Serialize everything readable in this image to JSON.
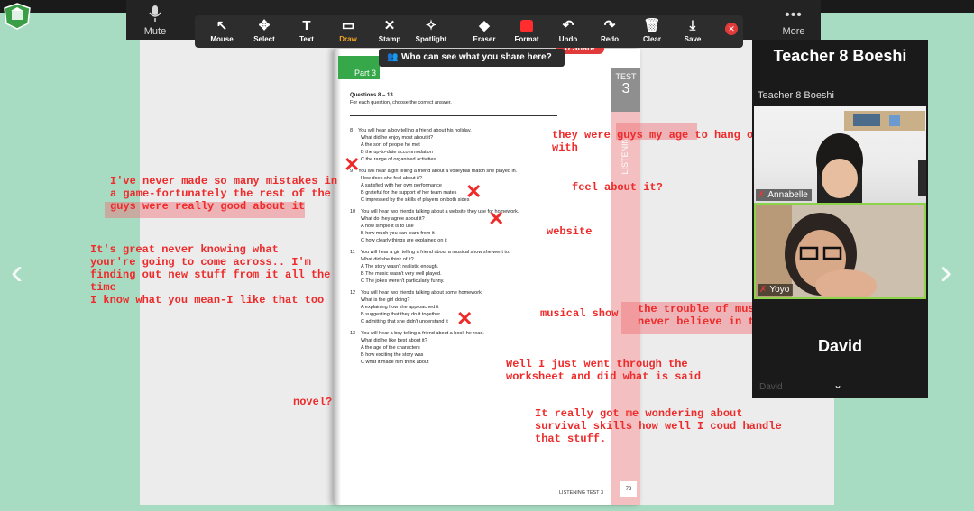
{
  "meeting_bar": {
    "mute_label": "Mute",
    "more_label": "More",
    "more_glyph": "•••",
    "mic_icon": "microphone-icon"
  },
  "annotation_toolbar": {
    "tools": [
      {
        "label": "Mouse",
        "icon": "mouse-pointer-icon",
        "glyph": "↖"
      },
      {
        "label": "Select",
        "icon": "select-move-icon",
        "glyph": "✥"
      },
      {
        "label": "Text",
        "icon": "text-icon",
        "glyph": "T"
      },
      {
        "label": "Draw",
        "icon": "draw-icon",
        "glyph": "▭",
        "active": true
      },
      {
        "label": "Stamp",
        "icon": "stamp-icon",
        "glyph": "✕"
      },
      {
        "label": "Spotlight",
        "icon": "spotlight-icon",
        "glyph": "✧"
      },
      {
        "label": "Eraser",
        "icon": "eraser-icon",
        "glyph": "◆"
      },
      {
        "label": "Format",
        "icon": "format-icon",
        "glyph": ""
      },
      {
        "label": "Undo",
        "icon": "undo-icon",
        "glyph": "↶"
      },
      {
        "label": "Redo",
        "icon": "redo-icon",
        "glyph": "↷"
      },
      {
        "label": "Clear",
        "icon": "trash-icon",
        "glyph": "🗑"
      },
      {
        "label": "Save",
        "icon": "save-icon",
        "glyph": "⤓"
      }
    ],
    "active_color": "#f5a623",
    "format_color": "#ff2d2d"
  },
  "share": {
    "question": "Who can see what you share here?",
    "pill_label": "o Share"
  },
  "book": {
    "part_label": "Part 3",
    "test_label": "TEST",
    "test_number": "3",
    "side_label": "LISTENING",
    "heading": "Questions 8 – 13",
    "instruction": "For each question, choose the correct answer.",
    "footer": "LISTENING TEST 3",
    "page_number": "73",
    "questions": [
      {
        "num": "8",
        "stem": "You will hear a boy telling a friend about his holiday.",
        "stem2": "What did he enjoy most about it?",
        "options": [
          "A   the sort of people he met",
          "B   the up-to-date accommodation",
          "C   the range of organised activities"
        ]
      },
      {
        "num": "9",
        "stem": "You will hear a girl telling a friend about a volleyball match she played in.",
        "stem2": "How does she feel about it?",
        "options": [
          "A   satisfied with her own performance",
          "B   grateful for the support of her team mates",
          "C   impressed by the skills of players on both sides"
        ]
      },
      {
        "num": "10",
        "stem": "You will hear two friends talking about a website they use for homework.",
        "stem2": "What do they agree about it?",
        "options": [
          "A   how simple it is to use",
          "B   how much you can learn from it",
          "C   how clearly things are explained on it"
        ]
      },
      {
        "num": "11",
        "stem": "You will hear a girl telling a friend about a musical show she went to.",
        "stem2": "What did she think of it?",
        "options": [
          "A   The story wasn't realistic enough.",
          "B   The music wasn't very well played.",
          "C   The jokes weren't particularly funny."
        ]
      },
      {
        "num": "12",
        "stem": "You will hear two friends talking about some homework.",
        "stem2": "What is the girl doing?",
        "options": [
          "A   explaining how she approached it",
          "B   suggesting that they do it together",
          "C   admitting that she didn't understand it"
        ]
      },
      {
        "num": "13",
        "stem": "You will hear a boy telling a friend about a book he read.",
        "stem2": "What did he like best about it?",
        "options": [
          "A   the age of the characters",
          "B   how exciting the story was",
          "C   what it made him think about"
        ]
      }
    ]
  },
  "annotations": {
    "left_1": "I've never made so many mistakes in\na game-fortunately the rest of the\nguys were really good about it",
    "left_2": "It's great never knowing what\nyour're going to come across.. I'm\nfinding out new stuff from it all the\ntime\nI know what you mean-I like that too",
    "novel": "novel?",
    "right_1": "they were guys my age to hang o\nwith",
    "right_2": "feel about it?",
    "right_3": "website",
    "right_4": "musical show",
    "right_5": "the trouble of musi\nnever believe in the",
    "right_6": "Well I just went through the\nworksheet and did what is said",
    "right_7": "It really got me wondering about\nsurvival skills how well I coud handle\nthat stuff.",
    "ink_color": "#ee2a2a"
  },
  "panel": {
    "title": "Teacher 8 Boeshi",
    "active_speaker": "Teacher 8 Boeshi",
    "participants": [
      {
        "name": "Annabelle"
      },
      {
        "name": "Yoyo"
      }
    ],
    "david_large": "David",
    "david_small": "David",
    "chevron": "⌄"
  }
}
